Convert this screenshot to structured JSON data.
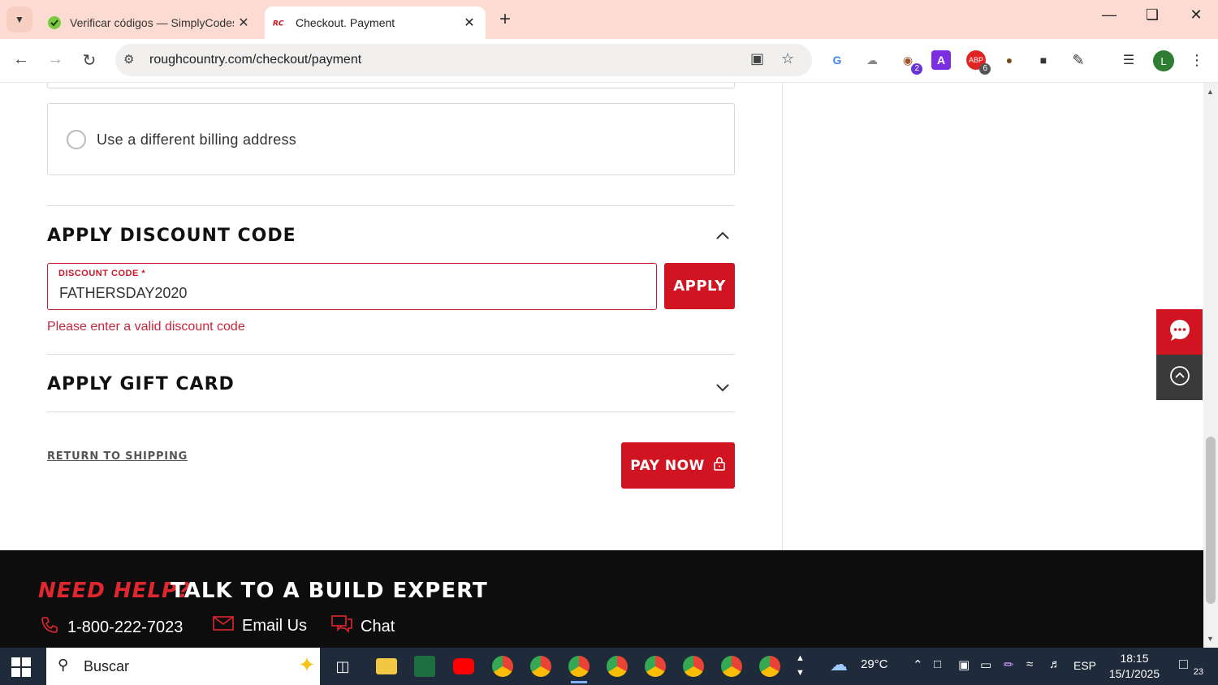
{
  "browser": {
    "tabs": [
      {
        "title": "Verificar códigos — SimplyCodes",
        "active": false
      },
      {
        "title": "Checkout. Payment",
        "active": true
      }
    ],
    "url": "roughcountry.com/checkout/payment",
    "extension_badges": {
      "ext3": "2",
      "ext5": "6"
    },
    "profile_initial": "L"
  },
  "page": {
    "billing": {
      "different_address_label": "Use a different billing address"
    },
    "discount": {
      "section_title": "APPLY DISCOUNT CODE",
      "field_label": "DISCOUNT CODE *",
      "field_value": "FATHERSDAY2020",
      "apply_label": "APPLY",
      "error_message": "Please enter a valid discount code"
    },
    "gift_card": {
      "section_title": "APPLY GIFT CARD"
    },
    "return_link": "RETURN TO SHIPPING",
    "pay_label": "PAY NOW"
  },
  "footer": {
    "need_help": "NEED HELP?",
    "talk": "TALK TO A BUILD EXPERT",
    "phone": "1-800-222-7023",
    "email": "Email Us",
    "chat": "Chat"
  },
  "taskbar": {
    "search_placeholder": "Buscar",
    "weather": "29°C",
    "language": "ESP",
    "time": "18:15",
    "date": "15/1/2025",
    "notifications": "23"
  },
  "colors": {
    "brand_red": "#d01422",
    "error_red": "#c7263a",
    "tab_bar": "#fcdcd2"
  }
}
